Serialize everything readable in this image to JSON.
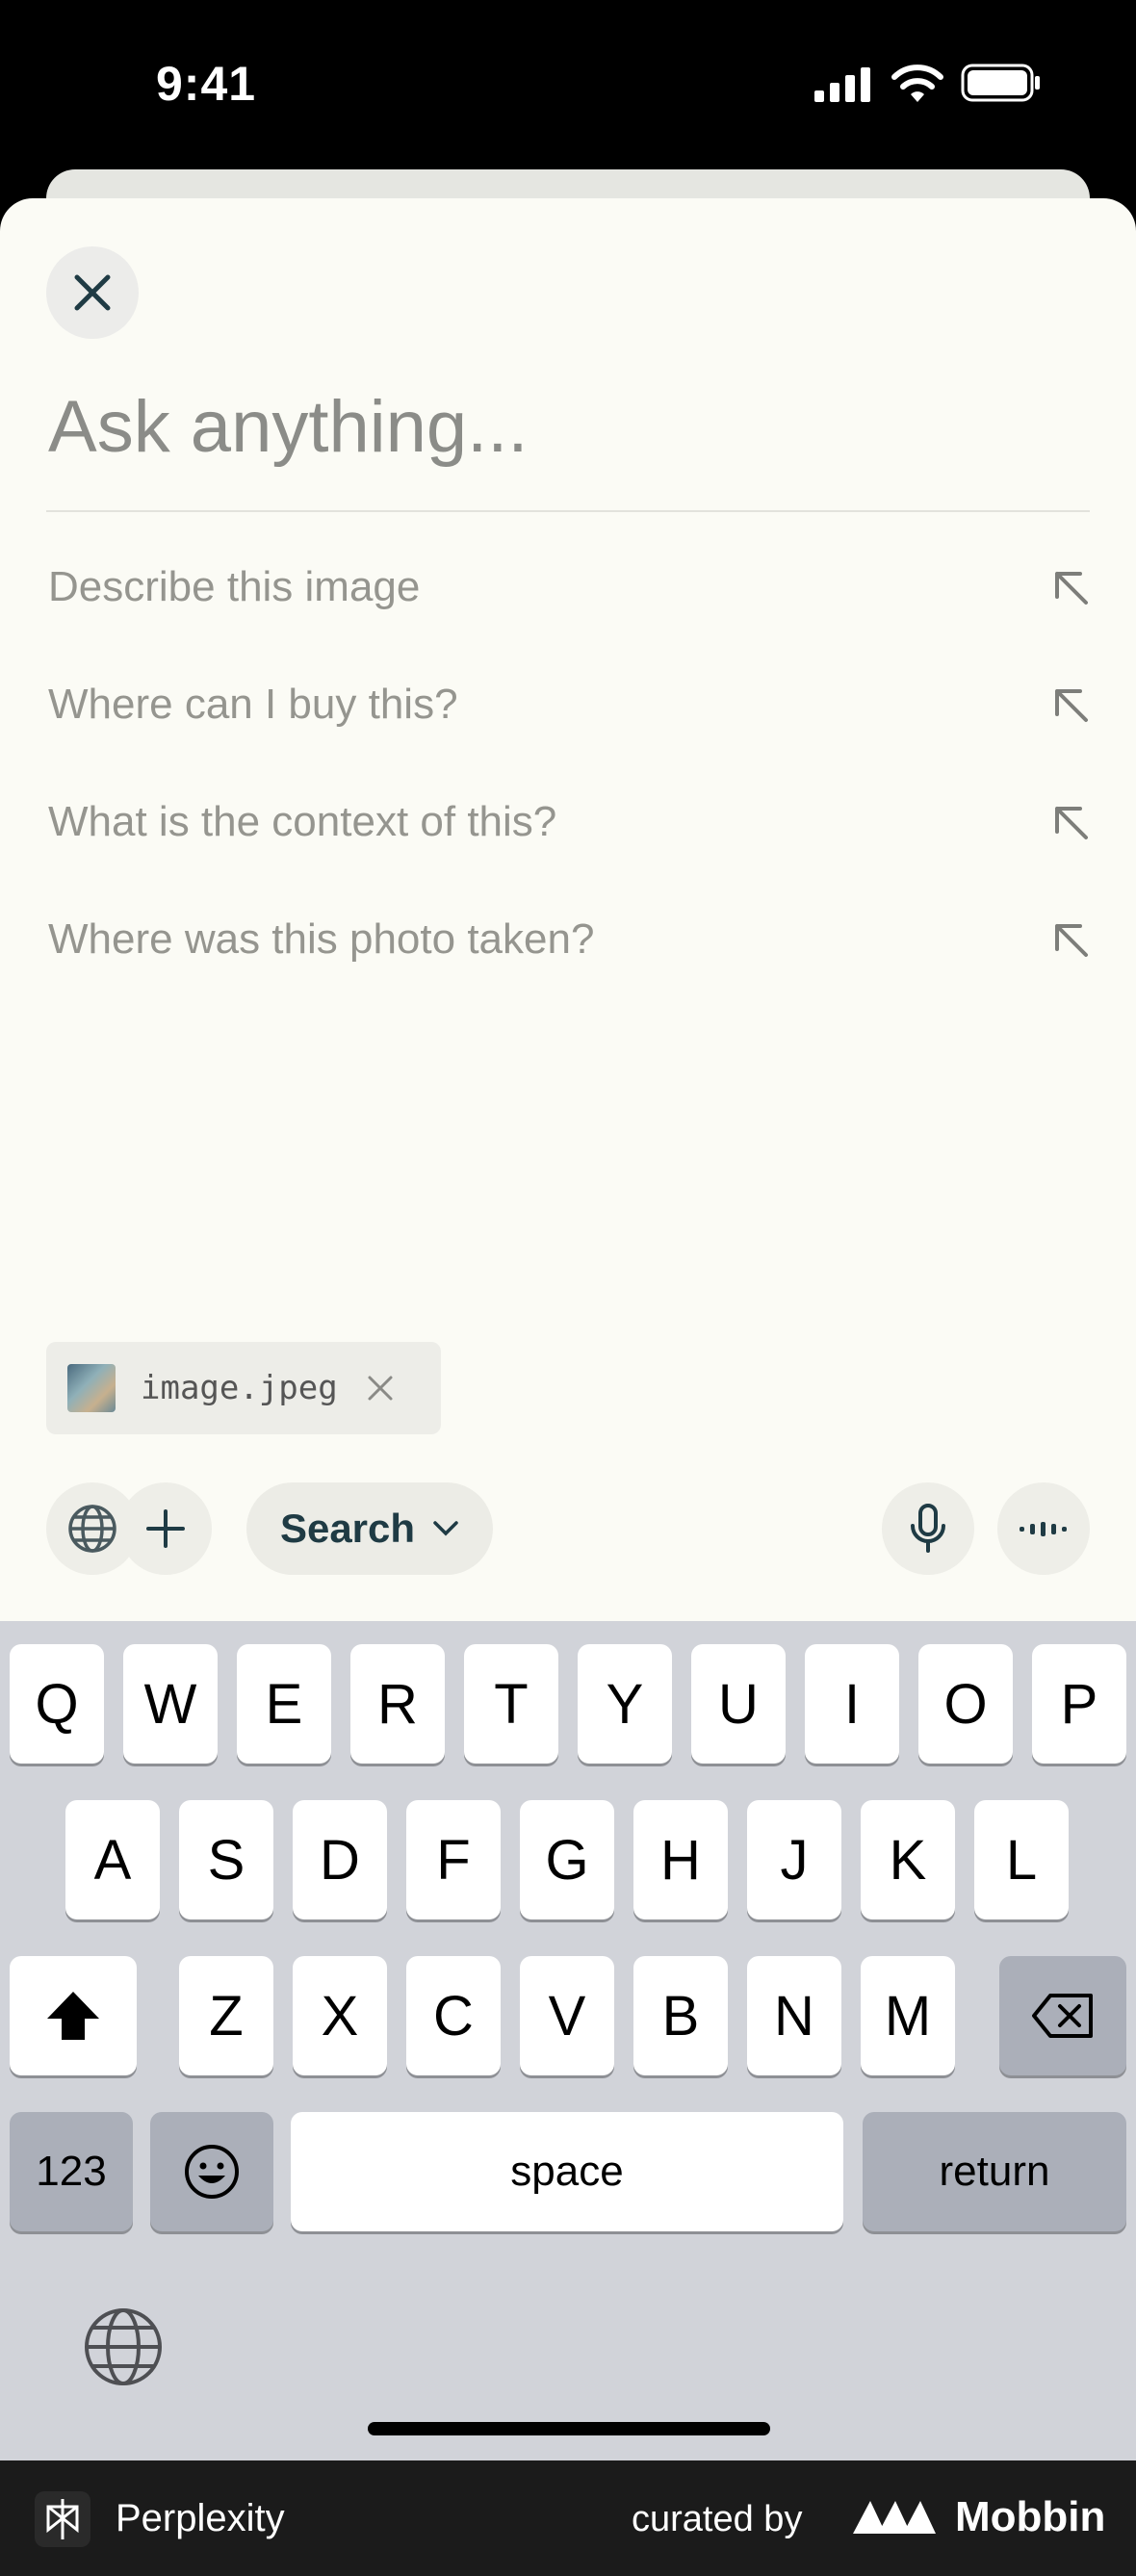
{
  "status_bar": {
    "time": "9:41"
  },
  "composer": {
    "placeholder": "Ask anything...",
    "suggestions": [
      {
        "label": "Describe this image"
      },
      {
        "label": "Where can I buy this?"
      },
      {
        "label": "What is the context of this?"
      },
      {
        "label": "Where was this photo taken?"
      }
    ],
    "attachment": {
      "name": "image.jpeg"
    },
    "mode_label": "Search"
  },
  "keyboard": {
    "row1": [
      "Q",
      "W",
      "E",
      "R",
      "T",
      "Y",
      "U",
      "I",
      "O",
      "P"
    ],
    "row2": [
      "A",
      "S",
      "D",
      "F",
      "G",
      "H",
      "J",
      "K",
      "L"
    ],
    "row3": [
      "Z",
      "X",
      "C",
      "V",
      "B",
      "N",
      "M"
    ],
    "numbers_label": "123",
    "space_label": "space",
    "return_label": "return"
  },
  "footer": {
    "app_name": "Perplexity",
    "curated_by": "curated by",
    "brand": "Mobbin"
  },
  "colors": {
    "sheet_bg": "#fbfbf5",
    "accent": "#1f3b44",
    "keyboard_bg": "#d1d3d9"
  }
}
